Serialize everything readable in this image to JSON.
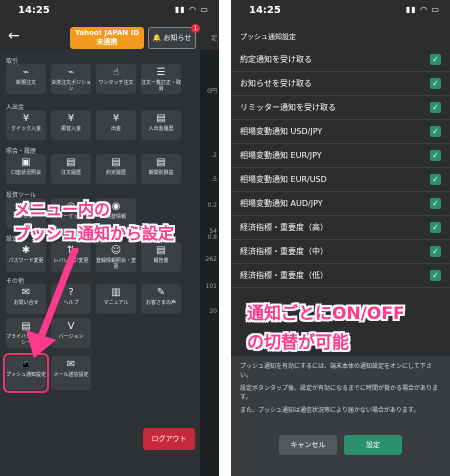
{
  "left": {
    "status_time": "14:25",
    "status_icons": "▮▮ ◠ ▭",
    "back_label": "←",
    "yahoo_line1": "Yahoo! JAPAN ID",
    "yahoo_line2": "未連携",
    "notif_label": "🔔 お知らせ",
    "notif_count": "1",
    "sections": {
      "torihiki": "取引",
      "nyushukkin": "入出金",
      "shokai": "照会・履歴",
      "toushi_tool": "投資ツール",
      "settei": "設定",
      "sonota": "その他"
    },
    "tiles": {
      "shinki": "新規注文",
      "kessai": "決済注文ポジション",
      "onetouch": "ワンタッチ注文",
      "ichiran": "注文一覧訂正・取消",
      "quick": "クイック入金",
      "furikae": "振替入金",
      "shukkin": "出金",
      "nyushukkin_rireki": "入出金履歴",
      "koza": "口座状況照会",
      "chumon_rireki": "注文履歴",
      "yakujo": "約定履歴",
      "kikanbetsu": "期間別損益",
      "calendar": "カレンダー",
      "market": "マーケット",
      "kawase": "為替情報",
      "password": "パスワード変更",
      "leverage": "レバレッジ変更",
      "toroku": "登録情報照会・変更",
      "hokoku": "報告書",
      "toiawase": "お問い合せ",
      "help": "ヘルプ",
      "manual": "マニュアル",
      "okyaku": "お客さまの声",
      "privacy": "プライバシーポリシー",
      "version": "バージョン",
      "push": "プッシュ通知設定",
      "mail": "メール送信設定"
    },
    "logout": "ログアウト",
    "sidebar_values": [
      "定",
      "0円",
      ".2",
      ".5",
      "0.2",
      "54",
      "0.8",
      "262",
      "101",
      "20"
    ],
    "annotation_line1": "メニュー内の",
    "annotation_line2": "プッシュ通知から設定"
  },
  "right": {
    "status_time": "14:25",
    "status_icons": "▮▮ ◠ ▭",
    "header_title": "プッシュ通知設定",
    "side_fragment": "定",
    "rows": [
      "約定通知を受け取る",
      "お知らせを受け取る",
      "リミッター通知を受け取る",
      "相場変動通知 USD/JPY",
      "相場変動通知 EUR/JPY",
      "相場変動通知 EUR/USD",
      "相場変動通知 AUD/JPY",
      "経済指標・重要度（高）",
      "経済指標・重要度（中）",
      "経済指標・重要度（低）"
    ],
    "check_mark": "✓",
    "annotation_line1": "通知ごとにON/OFF",
    "annotation_line2": "の切替が可能",
    "note1": "プッシュ通知を有効にするには、端末本体の通知設定をオンにして下さい。",
    "note2": "設定ボタンタップ後、設定が有効になるまでに時間が掛かる場合があります。",
    "note3": "また、プッシュ通知は通信状況等により届かない場合があります。",
    "cancel": "キャンセル",
    "ok": "設定"
  },
  "colors": {
    "accent_pink": "#ff3a8c",
    "check_green": "#2c8f6e",
    "logout_red": "#c7283c",
    "yahoo_orange": "#f39a1e"
  }
}
